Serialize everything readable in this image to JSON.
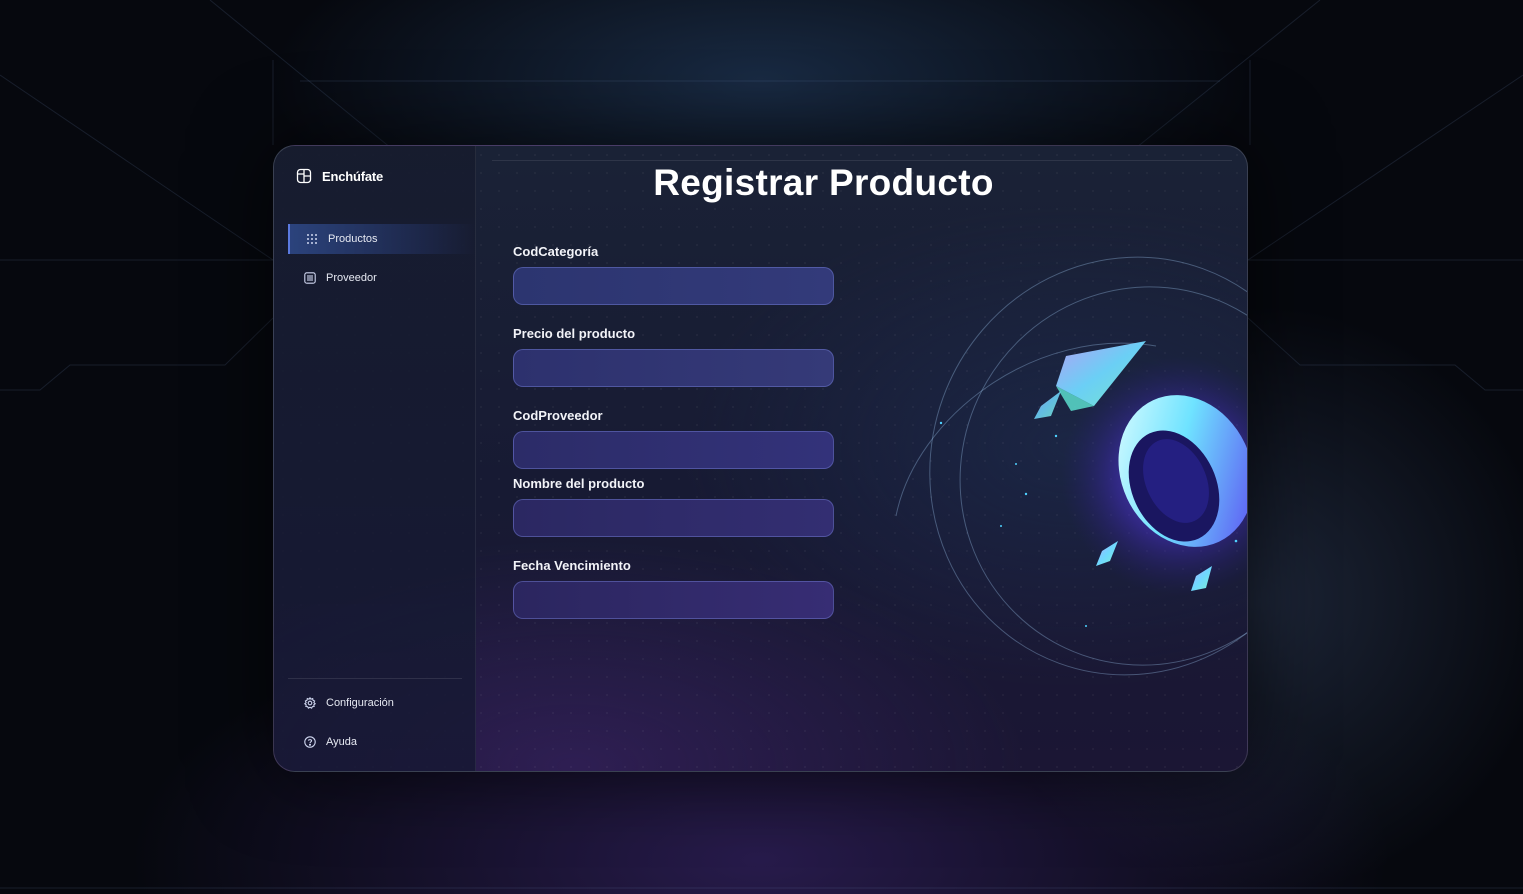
{
  "app": {
    "name": "Enchúfate",
    "logo_icon": "grid-layout-icon"
  },
  "sidebar": {
    "items": [
      {
        "label": "Productos",
        "icon": "grid-dots-icon",
        "active": true
      },
      {
        "label": "Proveedor",
        "icon": "list-icon",
        "active": false
      }
    ],
    "footer_items": [
      {
        "label": "Configuración",
        "icon": "gear-icon"
      },
      {
        "label": "Ayuda",
        "icon": "help-circle-icon"
      }
    ]
  },
  "main": {
    "title": "Registrar Producto",
    "fields": [
      {
        "label": "CodCategoría",
        "value": ""
      },
      {
        "label": "Precio del producto",
        "value": ""
      },
      {
        "label": "CodProveedor",
        "value": ""
      },
      {
        "label": "Nombre del producto",
        "value": ""
      },
      {
        "label": "Fecha Vencimiento",
        "value": ""
      }
    ]
  },
  "colors": {
    "accent": "#5b7ae0",
    "input_fill": "#2f3573",
    "orb_glow": "#6a4cff"
  }
}
